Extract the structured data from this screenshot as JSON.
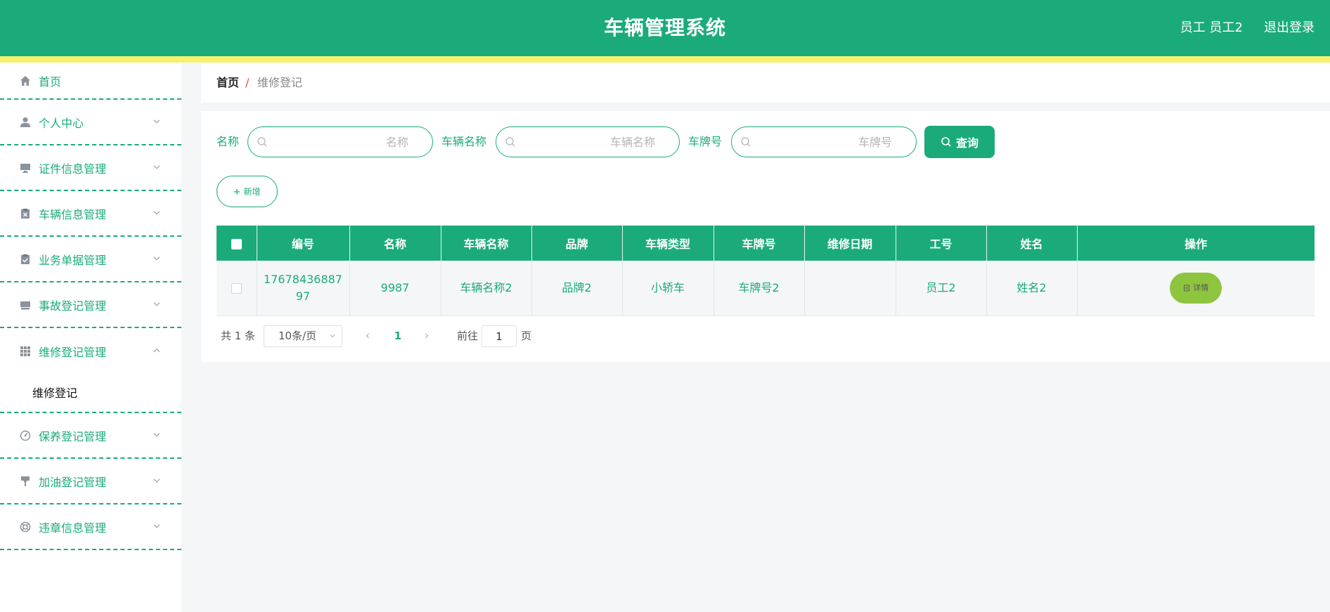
{
  "header": {
    "title": "车辆管理系统",
    "user": "员工 员工2",
    "logout": "退出登录"
  },
  "sidebar": {
    "items": [
      {
        "label": "首页",
        "icon": "home-icon"
      },
      {
        "label": "个人中心",
        "icon": "user-icon"
      },
      {
        "label": "证件信息管理",
        "icon": "monitor-icon"
      },
      {
        "label": "车辆信息管理",
        "icon": "clipboard-x-icon"
      },
      {
        "label": "业务单据管理",
        "icon": "clipboard-check-icon"
      },
      {
        "label": "事故登记管理",
        "icon": "inbox-icon"
      },
      {
        "label": "维修登记管理",
        "icon": "grid-icon"
      },
      {
        "label": "保养登记管理",
        "icon": "gauge-icon"
      },
      {
        "label": "加油登记管理",
        "icon": "brush-icon"
      },
      {
        "label": "违章信息管理",
        "icon": "lifebuoy-icon"
      }
    ],
    "submenu": {
      "label": "维修登记"
    }
  },
  "breadcrumb": {
    "home": "首页",
    "separator": "/",
    "current": "维修登记"
  },
  "search": {
    "name_label": "名称",
    "name_placeholder": "名称",
    "vehicle_label": "车辆名称",
    "vehicle_placeholder": "车辆名称",
    "plate_label": "车牌号",
    "plate_placeholder": "车牌号",
    "query_button": "查询"
  },
  "toolbar": {
    "add_button": "新增"
  },
  "table": {
    "headers": [
      "编号",
      "名称",
      "车辆名称",
      "品牌",
      "车辆类型",
      "车牌号",
      "维修日期",
      "工号",
      "姓名",
      "操作"
    ],
    "rows": [
      {
        "id": "1767843688797",
        "name": "9987",
        "vehicle_name": "车辆名称2",
        "brand": "品牌2",
        "vehicle_type": "小轿车",
        "plate": "车牌号2",
        "repair_date": "",
        "employee_no": "员工2",
        "employee_name": "姓名2",
        "action": "详情"
      }
    ]
  },
  "pagination": {
    "total": "共 1 条",
    "page_size": "10条/页",
    "current_page": "1",
    "goto_label": "前往",
    "goto_value": "1",
    "page_suffix": "页"
  },
  "colors": {
    "primary": "#1bab7b",
    "stripe": "#f4f36b",
    "detail_button": "#8dc53e"
  }
}
